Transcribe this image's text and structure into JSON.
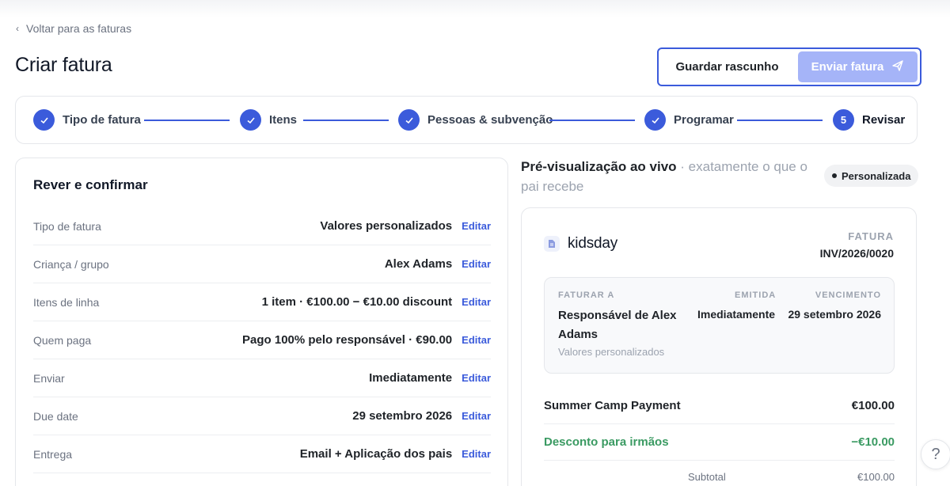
{
  "nav": {
    "back_label": "Voltar para as faturas"
  },
  "page": {
    "title": "Criar fatura"
  },
  "actions": {
    "draft_label": "Guardar rascunho",
    "send_label": "Enviar fatura"
  },
  "steps": [
    {
      "label": "Tipo de fatura",
      "state": "done"
    },
    {
      "label": "Itens",
      "state": "done"
    },
    {
      "label": "Pessoas & subvenção",
      "state": "done"
    },
    {
      "label": "Programar",
      "state": "done"
    },
    {
      "label": "Revisar",
      "state": "active",
      "number": "5"
    }
  ],
  "review": {
    "heading": "Rever e confirmar",
    "edit_label": "Editar",
    "rows": [
      {
        "key": "Tipo de fatura",
        "value": "Valores personalizados"
      },
      {
        "key": "Criança / grupo",
        "value": "Alex Adams"
      },
      {
        "key": "Itens de linha",
        "value": "1 item · €100.00 − €10.00 discount"
      },
      {
        "key": "Quem paga",
        "value": "Pago 100% pelo responsável · €90.00"
      },
      {
        "key": "Enviar",
        "value": "Imediatamente"
      },
      {
        "key": "Due date",
        "value": "29 setembro 2026"
      },
      {
        "key": "Entrega",
        "value": "Email + Aplicação dos pais"
      }
    ]
  },
  "preview": {
    "title": "Pré-visualização ao vivo",
    "subtitle": "· exatamente o que o pai recebe",
    "badge": "Personalizada",
    "brand": "kidsday",
    "invoice_label": "FATURA",
    "invoice_number": "INV/2026/0020",
    "bill_to_caption": "FATURAR A",
    "bill_to_name": "Responsável de Alex Adams",
    "bill_to_sub": "Valores personalizados",
    "issued_caption": "EMITIDA",
    "issued_value": "Imediatamente",
    "due_caption": "VENCIMENTO",
    "due_value": "29 setembro 2026",
    "lines": [
      {
        "label": "Summer Camp Payment",
        "amount": "€100.00"
      },
      {
        "label": "Desconto para irmãos",
        "amount": "−€10.00"
      }
    ],
    "subtotal_label": "Subtotal",
    "subtotal_value": "€100.00"
  },
  "help": {
    "label": "?"
  },
  "colors": {
    "accent": "#3b5bdb",
    "send_button": "#a5b4f8",
    "discount": "#3a9a62"
  }
}
